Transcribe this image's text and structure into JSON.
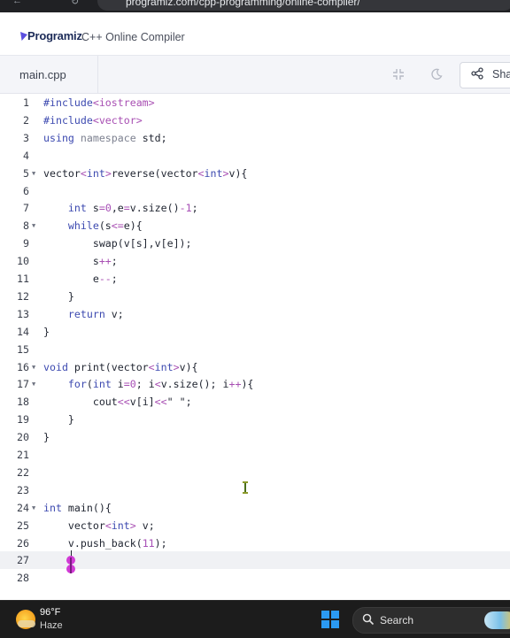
{
  "browser": {
    "url": "programiz.com/cpp-programming/online-compiler/"
  },
  "header": {
    "logo": "Programiz",
    "title": "C++ Online Compiler"
  },
  "tabs": {
    "file": "main.cpp",
    "share_label": "Share"
  },
  "icons": {
    "fullscreen": "fullscreen-icon",
    "theme": "moon-icon",
    "share": "share-icon",
    "fold": "fold-arrow-icon",
    "weather": "sun-cloud-icon",
    "windows": "windows-start-icon",
    "search": "search-icon"
  },
  "colors": {
    "keyword": "#3d4ab0",
    "string_num": "#a84fb3",
    "active_line": "#f0f1f4"
  },
  "editor": {
    "active_line": 27,
    "lines": [
      {
        "n": "1",
        "fold": false,
        "html": "<span class=\"k\">#include</span><span class=\"pp\">&lt;iostream&gt;</span>"
      },
      {
        "n": "2",
        "fold": false,
        "html": "<span class=\"k\">#include</span><span class=\"pp\">&lt;vector&gt;</span>"
      },
      {
        "n": "3",
        "fold": false,
        "html": "<span class=\"k\">using</span> <span class=\"dim\">namespace</span> std;"
      },
      {
        "n": "4",
        "fold": false,
        "html": ""
      },
      {
        "n": "5",
        "fold": true,
        "html": "vector<span class=\"op\">&lt;</span><span class=\"k\">int</span><span class=\"op\">&gt;</span>reverse(vector<span class=\"op\">&lt;</span><span class=\"k\">int</span><span class=\"op\">&gt;</span>v){"
      },
      {
        "n": "6",
        "fold": false,
        "html": ""
      },
      {
        "n": "7",
        "fold": false,
        "html": "    <span class=\"k\">int</span> s<span class=\"op\">=</span><span class=\"n\">0</span>,e<span class=\"op\">=</span>v.size()<span class=\"op\">-</span><span class=\"n\">1</span>;"
      },
      {
        "n": "8",
        "fold": true,
        "html": "    <span class=\"k\">while</span>(s<span class=\"op\">&lt;=</span>e){"
      },
      {
        "n": "9",
        "fold": false,
        "html": "        swap(v[s],v[e]);"
      },
      {
        "n": "10",
        "fold": false,
        "html": "        s<span class=\"op\">++</span>;"
      },
      {
        "n": "11",
        "fold": false,
        "html": "        e<span class=\"op\">--</span>;"
      },
      {
        "n": "12",
        "fold": false,
        "html": "    }"
      },
      {
        "n": "13",
        "fold": false,
        "html": "    <span class=\"k\">return</span> v;"
      },
      {
        "n": "14",
        "fold": false,
        "html": "}"
      },
      {
        "n": "15",
        "fold": false,
        "html": ""
      },
      {
        "n": "16",
        "fold": true,
        "html": "<span class=\"k\">void</span> print(vector<span class=\"op\">&lt;</span><span class=\"k\">int</span><span class=\"op\">&gt;</span>v){"
      },
      {
        "n": "17",
        "fold": true,
        "html": "    <span class=\"k\">for</span>(<span class=\"k\">int</span> i<span class=\"op\">=</span><span class=\"n\">0</span>; i<span class=\"op\">&lt;</span>v.size(); i<span class=\"op\">++</span>){"
      },
      {
        "n": "18",
        "fold": false,
        "html": "        cout<span class=\"op\">&lt;&lt;</span>v[i]<span class=\"op\">&lt;&lt;</span>\" \";"
      },
      {
        "n": "19",
        "fold": false,
        "html": "    }"
      },
      {
        "n": "20",
        "fold": false,
        "html": "}"
      },
      {
        "n": "21",
        "fold": false,
        "html": ""
      },
      {
        "n": "22",
        "fold": false,
        "html": ""
      },
      {
        "n": "23",
        "fold": false,
        "html": ""
      },
      {
        "n": "24",
        "fold": true,
        "html": "<span class=\"k\">int</span> main(){"
      },
      {
        "n": "25",
        "fold": false,
        "html": "    vector<span class=\"op\">&lt;</span><span class=\"k\">int</span><span class=\"op\">&gt;</span> v;"
      },
      {
        "n": "26",
        "fold": false,
        "html": "    v.push_back(<span class=\"n\">11</span>);"
      },
      {
        "n": "27",
        "fold": false,
        "html": "    "
      },
      {
        "n": "28",
        "fold": false,
        "html": ""
      }
    ]
  },
  "taskbar": {
    "temp": "96°F",
    "condition": "Haze",
    "search_label": "Search"
  }
}
